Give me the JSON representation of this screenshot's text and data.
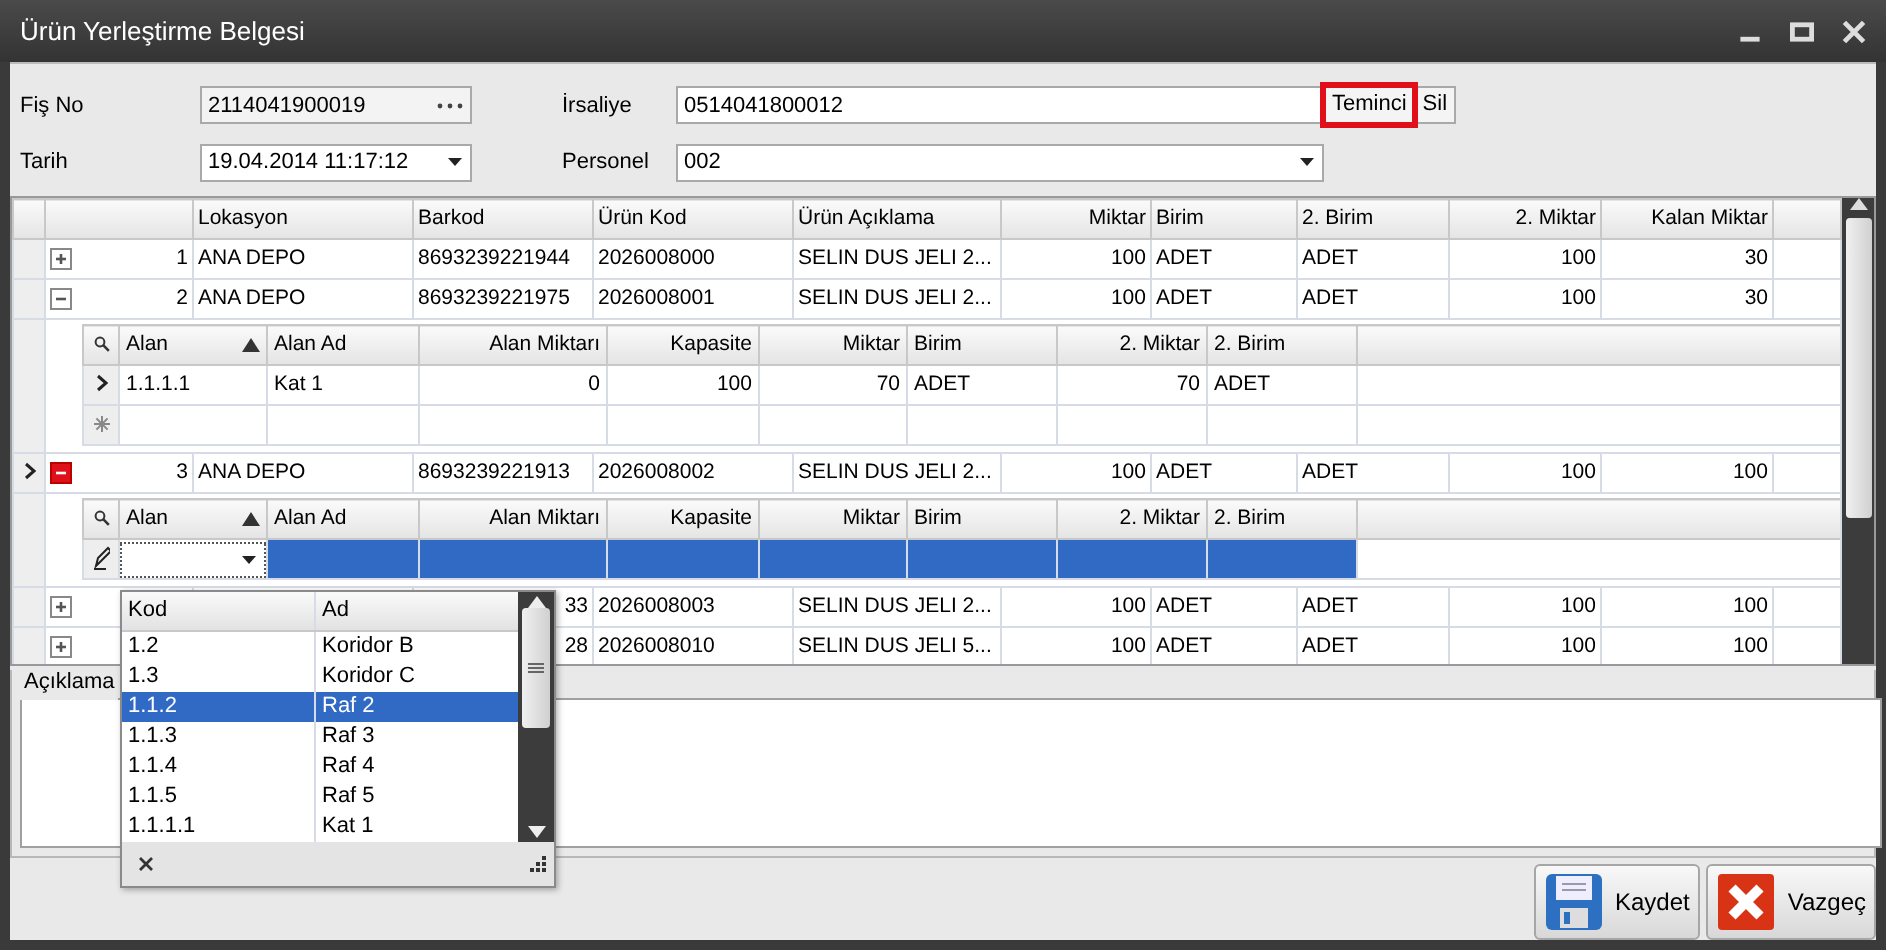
{
  "window": {
    "title": "Ürün Yerleştirme Belgesi"
  },
  "form": {
    "fields": [
      {
        "label": "Fiş No",
        "value": "2114041900019",
        "kind": "lookup"
      },
      {
        "label": "İrsaliye",
        "value": "0514041800012",
        "kind": "text"
      },
      {
        "label": "Tarih",
        "value": "19.04.2014 11:17:12",
        "kind": "combo"
      },
      {
        "label": "Personel",
        "value": "002",
        "kind": "combo"
      }
    ],
    "buttons": [
      {
        "label": "Teminci",
        "highlighted": true
      },
      {
        "label": "Sil",
        "highlighted": false
      }
    ]
  },
  "grid": {
    "columns": [
      {
        "label": "Lokasyon",
        "numeric": false
      },
      {
        "label": "Barkod",
        "numeric": false
      },
      {
        "label": "Ürün Kod",
        "numeric": false
      },
      {
        "label": "Ürün Açıklama",
        "numeric": false
      },
      {
        "label": "Miktar",
        "numeric": true
      },
      {
        "label": "Birim",
        "numeric": false
      },
      {
        "label": "2. Birim",
        "numeric": false
      },
      {
        "label": "2. Miktar",
        "numeric": true
      },
      {
        "label": "Kalan Miktar",
        "numeric": true
      }
    ],
    "rows": [
      {
        "number": "1",
        "expanded": false,
        "current": false,
        "partly_covered": false,
        "cells": [
          "ANA DEPO",
          "8693239221944",
          "2026008000",
          "SELIN DUS JELI 2...",
          "100",
          "ADET",
          "ADET",
          "100",
          "30"
        ]
      },
      {
        "number": "2",
        "expanded": true,
        "current": false,
        "partly_covered": false,
        "cells": [
          "ANA DEPO",
          "8693239221975",
          "2026008001",
          "SELIN DUS JELI 2...",
          "100",
          "ADET",
          "ADET",
          "100",
          "30"
        ],
        "detail": {
          "editing": false,
          "columns": [
            {
              "label": "Alan",
              "numeric": false,
              "sorted_ascending": true
            },
            {
              "label": "Alan Ad",
              "numeric": false,
              "sorted_ascending": false
            },
            {
              "label": "Alan Miktarı",
              "numeric": true,
              "sorted_ascending": false
            },
            {
              "label": "Kapasite",
              "numeric": true,
              "sorted_ascending": false
            },
            {
              "label": "Miktar",
              "numeric": true,
              "sorted_ascending": false
            },
            {
              "label": "Birim",
              "numeric": false,
              "sorted_ascending": false
            },
            {
              "label": "2. Miktar",
              "numeric": true,
              "sorted_ascending": false
            },
            {
              "label": "2. Birim",
              "numeric": false,
              "sorted_ascending": false
            }
          ],
          "rows": [
            {
              "current": true,
              "cells": [
                "1.1.1.1",
                "Kat 1",
                "0",
                "100",
                "70",
                "ADET",
                "70",
                "ADET"
              ]
            }
          ]
        }
      },
      {
        "number": "3",
        "expanded": true,
        "current": true,
        "partly_covered": false,
        "cells": [
          "ANA DEPO",
          "8693239221913",
          "2026008002",
          "SELIN DUS JELI 2...",
          "100",
          "ADET",
          "ADET",
          "100",
          "100"
        ],
        "detail": {
          "editing": true,
          "columns": [
            {
              "label": "Alan",
              "numeric": false,
              "sorted_ascending": true
            },
            {
              "label": "Alan Ad",
              "numeric": false,
              "sorted_ascending": false
            },
            {
              "label": "Alan Miktarı",
              "numeric": true,
              "sorted_ascending": false
            },
            {
              "label": "Kapasite",
              "numeric": true,
              "sorted_ascending": false
            },
            {
              "label": "Miktar",
              "numeric": true,
              "sorted_ascending": false
            },
            {
              "label": "Birim",
              "numeric": false,
              "sorted_ascending": false
            },
            {
              "label": "2. Miktar",
              "numeric": true,
              "sorted_ascending": false
            },
            {
              "label": "2. Birim",
              "numeric": false,
              "sorted_ascending": false
            }
          ]
        }
      },
      {
        "number": null,
        "expanded": false,
        "current": false,
        "partly_covered": true,
        "cells": [
          null,
          "33",
          "2026008003",
          "SELIN DUS JELI 2...",
          "100",
          "ADET",
          "ADET",
          "100",
          "100"
        ]
      },
      {
        "number": null,
        "expanded": false,
        "current": false,
        "partly_covered": true,
        "cells": [
          null,
          "28",
          "2026008010",
          "SELIN DUS JELI 5...",
          "100",
          "ADET",
          "ADET",
          "100",
          "100"
        ]
      }
    ]
  },
  "dropdown": {
    "columns": [
      "Kod",
      "Ad"
    ],
    "rows": [
      {
        "cells": [
          "1.2",
          "Koridor B"
        ],
        "selected": false
      },
      {
        "cells": [
          "1.3",
          "Koridor C"
        ],
        "selected": false
      },
      {
        "cells": [
          "1.1.2",
          "Raf 2"
        ],
        "selected": true
      },
      {
        "cells": [
          "1.1.3",
          "Raf 3"
        ],
        "selected": false
      },
      {
        "cells": [
          "1.1.4",
          "Raf 4"
        ],
        "selected": false
      },
      {
        "cells": [
          "1.1.5",
          "Raf 5"
        ],
        "selected": false
      },
      {
        "cells": [
          "1.1.1.1",
          "Kat 1"
        ],
        "selected": false
      }
    ]
  },
  "notes": {
    "label": "Açıklama"
  },
  "actions": [
    {
      "label": "Kaydet",
      "kind": "save"
    },
    {
      "label": "Vazgeç",
      "kind": "cancel"
    }
  ]
}
